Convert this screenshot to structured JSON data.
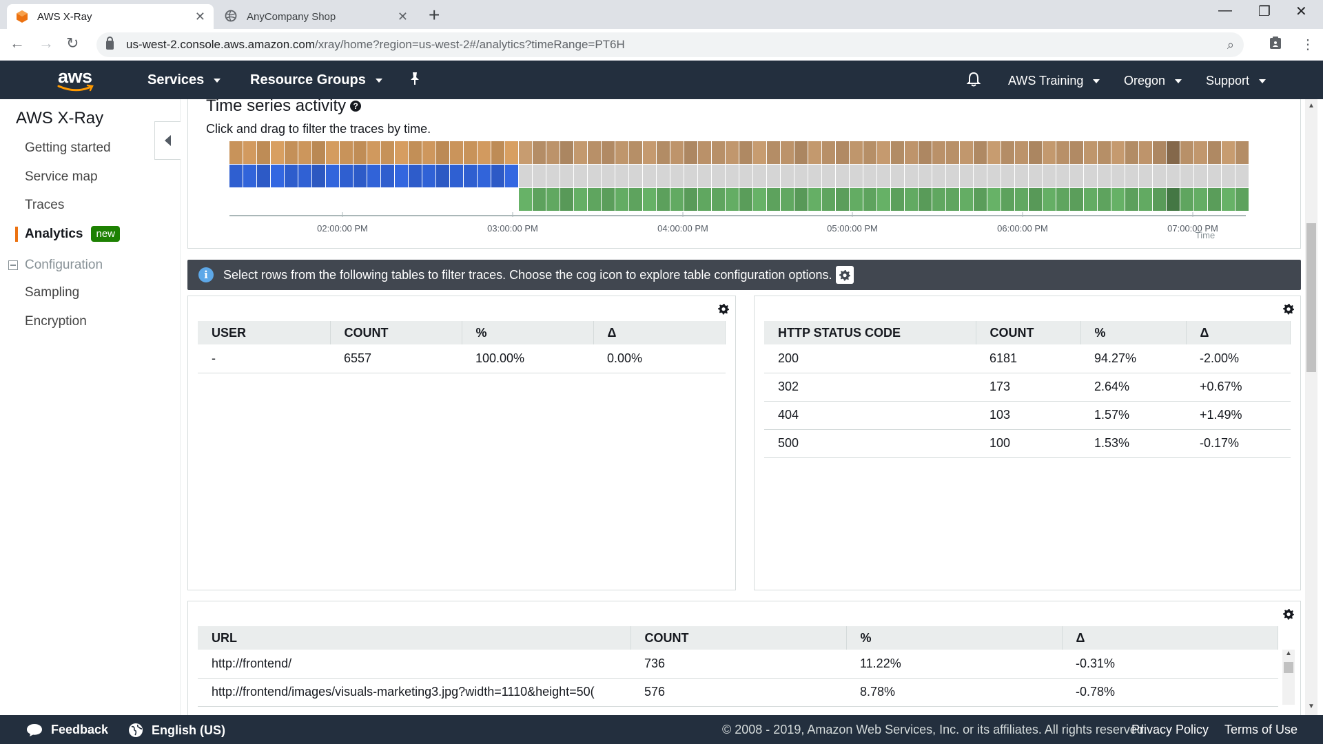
{
  "browser": {
    "tabs": [
      {
        "title": "AWS X-Ray",
        "active": true
      },
      {
        "title": "AnyCompany Shop",
        "active": false
      }
    ],
    "url_host": "us-west-2.console.aws.amazon.com",
    "url_path": "/xray/home?region=us-west-2#/analytics?timeRange=PT6H"
  },
  "header": {
    "logo": "aws",
    "services": "Services",
    "resource_groups": "Resource Groups",
    "account": "AWS Training",
    "region": "Oregon",
    "support": "Support"
  },
  "sidebar": {
    "title": "AWS X-Ray",
    "items": [
      {
        "label": "Getting started"
      },
      {
        "label": "Service map"
      },
      {
        "label": "Traces"
      },
      {
        "label": "Analytics",
        "badge": "new"
      }
    ],
    "config_label": "Configuration",
    "config_items": [
      {
        "label": "Sampling"
      },
      {
        "label": "Encryption"
      }
    ]
  },
  "timeseries": {
    "title": "Time series activity",
    "subtitle": "Click and drag to filter the traces by time.",
    "time_labels": [
      "02:00:00 PM",
      "03:00:00 PM",
      "04:00:00 PM",
      "05:00:00 PM",
      "06:00:00 PM",
      "07:00:00 PM"
    ],
    "axis_label": "Time",
    "colors": {
      "orange": "#c8935a",
      "blue": "#2f5fd0",
      "green": "#5fa55f",
      "grey": "#d5d5d5",
      "tan": "#b89068"
    }
  },
  "info_bar": {
    "text": "Select rows from the following tables to filter traces. Choose the cog icon to explore table configuration options."
  },
  "user_table": {
    "headers": [
      "USER",
      "COUNT",
      "%",
      "Δ"
    ],
    "rows": [
      [
        "-",
        "6557",
        "100.00%",
        "0.00%"
      ]
    ]
  },
  "status_table": {
    "headers": [
      "HTTP STATUS CODE",
      "COUNT",
      "%",
      "Δ"
    ],
    "rows": [
      [
        "200",
        "6181",
        "94.27%",
        "-2.00%"
      ],
      [
        "302",
        "173",
        "2.64%",
        "+0.67%"
      ],
      [
        "404",
        "103",
        "1.57%",
        "+1.49%"
      ],
      [
        "500",
        "100",
        "1.53%",
        "-0.17%"
      ]
    ]
  },
  "url_table": {
    "headers": [
      "URL",
      "COUNT",
      "%",
      "Δ"
    ],
    "rows": [
      [
        "http://frontend/",
        "736",
        "11.22%",
        "-0.31%"
      ],
      [
        "http://frontend/images/visuals-marketing3.jpg?width=1110&height=50(",
        "576",
        "8.78%",
        "-0.78%"
      ]
    ]
  },
  "footer": {
    "feedback": "Feedback",
    "language": "English (US)",
    "copyright": "© 2008 - 2019, Amazon Web Services, Inc. or its affiliates. All rights reserved.",
    "privacy": "Privacy Policy",
    "terms": "Terms of Use"
  }
}
